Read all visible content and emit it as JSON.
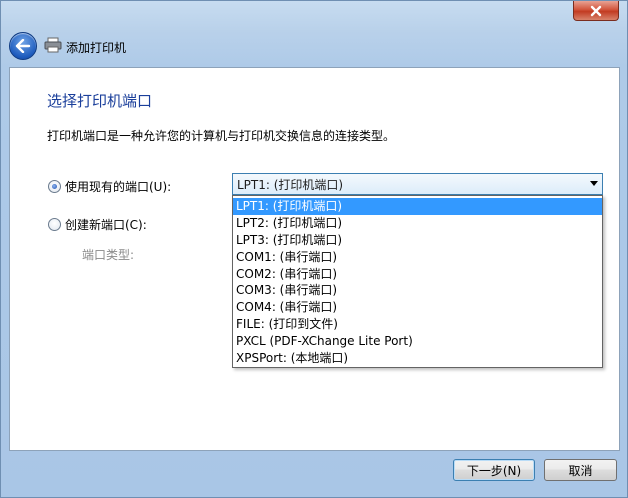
{
  "window": {
    "title": "添加打印机",
    "close_icon": "close-icon",
    "back_icon": "back-arrow-icon",
    "title_icon": "printer-icon"
  },
  "page": {
    "heading": "选择打印机端口",
    "description": "打印机端口是一种允许您的计算机与打印机交换信息的连接类型。"
  },
  "options": {
    "use_existing_label": "使用现有的端口(U):",
    "use_existing_selected": true,
    "create_new_label": "创建新端口(C):",
    "create_new_selected": false,
    "port_type_label": "端口类型:"
  },
  "combo": {
    "value": "LPT1: (打印机端口)",
    "items": [
      "LPT1: (打印机端口)",
      "LPT2: (打印机端口)",
      "LPT3: (打印机端口)",
      "COM1: (串行端口)",
      "COM2: (串行端口)",
      "COM3: (串行端口)",
      "COM4: (串行端口)",
      "FILE: (打印到文件)",
      "PXCL (PDF-XChange Lite Port)",
      "XPSPort: (本地端口)"
    ],
    "selected_index": 0
  },
  "buttons": {
    "next": "下一步(N)",
    "cancel": "取消"
  },
  "colors": {
    "heading": "#1b3f9b",
    "selection": "#3399ff",
    "window_frame": "#aecae8"
  }
}
